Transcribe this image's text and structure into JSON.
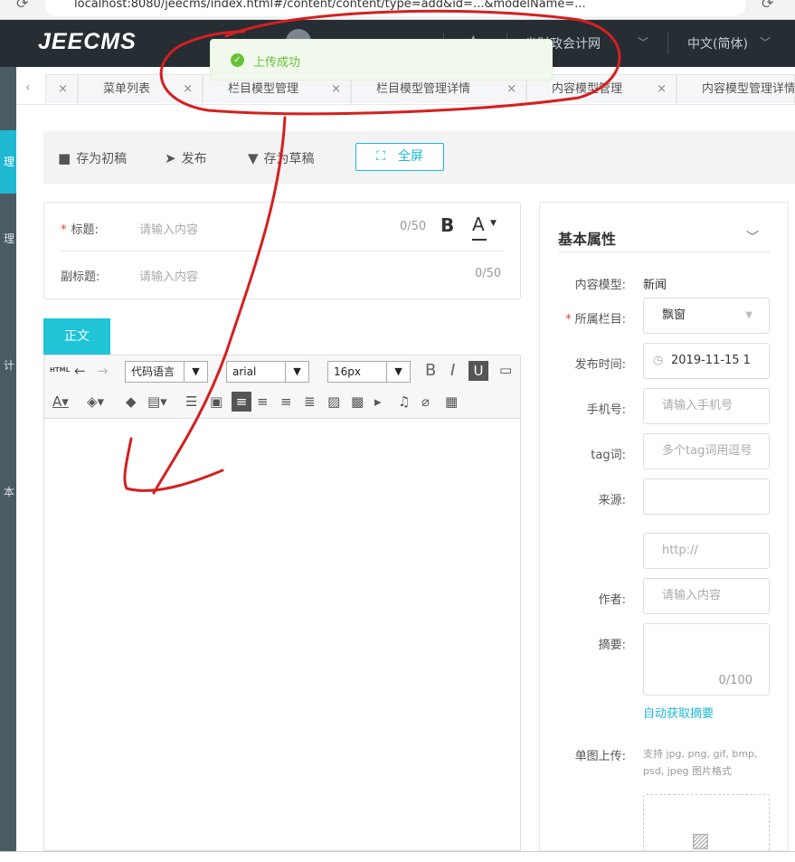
{
  "browser": {
    "url": "localhost:8080/jeecms/index.html#/content/content/type=add&id=...&modelName=..."
  },
  "topnav": {
    "logo": "JEECMS",
    "org": "省财政会计网",
    "lang": "中文(简体)"
  },
  "sidebar": {
    "items": [
      {
        "label": "",
        "active": false
      },
      {
        "label": "理",
        "active": true
      },
      {
        "label": "理",
        "active": false
      },
      {
        "label": "计",
        "active": false
      },
      {
        "label": "本",
        "active": false
      }
    ]
  },
  "tabs": [
    {
      "label": "",
      "closable": true
    },
    {
      "label": "菜单列表",
      "closable": true
    },
    {
      "label": "栏目模型管理",
      "closable": true
    },
    {
      "label": "栏目模型管理详情",
      "closable": true
    },
    {
      "label": "内容模型管理",
      "closable": true
    },
    {
      "label": "内容模型管理详情",
      "closable": false
    }
  ],
  "toolbar": {
    "save_draft_initial": "存为初稿",
    "publish": "发布",
    "save_draft": "存为草稿",
    "fullscreen": "全屏"
  },
  "title_fields": {
    "title_label": "标题:",
    "title_placeholder": "请输入内容",
    "title_count": "0/50",
    "subtitle_label": "副标题:",
    "subtitle_placeholder": "请输入内容",
    "subtitle_count": "0/50",
    "bold_glyph": "B",
    "color_glyph": "A"
  },
  "body_tab": "正文",
  "editor": {
    "html_label": "HTML",
    "code_lang": "代码语言",
    "font_family": "arial",
    "font_size": "16px"
  },
  "panel": {
    "title": "基本属性",
    "fields": {
      "content_model_label": "内容模型:",
      "content_model_value": "新闻",
      "column_label": "所属栏目:",
      "column_value": "飘窗",
      "publish_time_label": "发布时间:",
      "publish_time_value": "2019-11-15 1",
      "phone_label": "手机号:",
      "phone_placeholder": "请输入手机号",
      "tag_label": "tag词:",
      "tag_placeholder": "多个tag词用逗号",
      "source_label": "来源:",
      "source_url_placeholder": "http://",
      "author_label": "作者:",
      "author_placeholder": "请输入内容",
      "summary_label": "摘要:",
      "summary_count": "0/100",
      "auto_summary": "自动获取摘要",
      "image_label": "单图上传:",
      "image_hint": "支持 jpg, png, gif, bmp, psd, jpeg 图片格式"
    }
  },
  "toast": {
    "message": "上传成功",
    "color": "#67c23a"
  },
  "annotation_color": "#d42020"
}
